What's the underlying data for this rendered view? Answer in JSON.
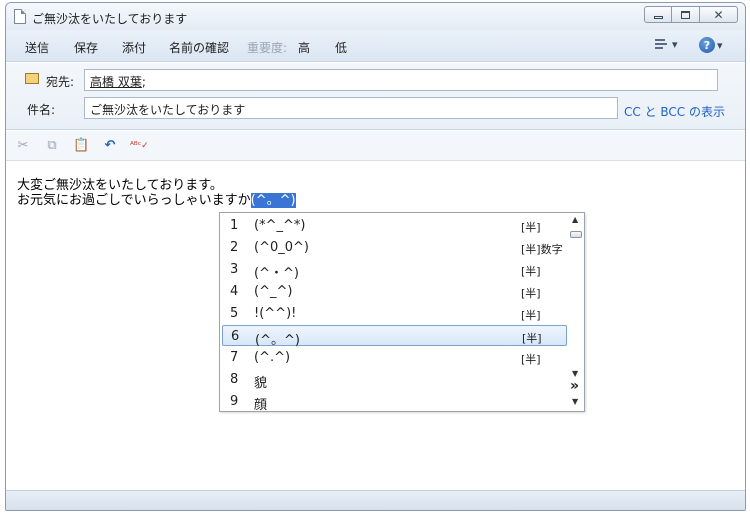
{
  "window": {
    "title": "ご無沙汰をいたしております"
  },
  "commands": {
    "send": "送信",
    "save": "保存",
    "attach": "添付",
    "check_names": "名前の確認",
    "importance_label": "重要度:",
    "high": "高",
    "low": "低"
  },
  "fields": {
    "to_label": "宛先:",
    "to_name": "高橋 双葉",
    "to_sep": ";",
    "subject_label": "件名:",
    "subject_value": "ご無沙汰をいたしております",
    "cc_bcc": "CC と BCC の表示"
  },
  "toolbar_icons": [
    "cut-icon",
    "copy-icon",
    "paste-icon",
    "undo-icon",
    "spellcheck-icon"
  ],
  "body": {
    "line1": "大変ご無沙汰をいたしております。",
    "line2_prefix": "お元気にお過ごしでいらっしゃいますか",
    "line2_selected": "(^。^)"
  },
  "candidates": [
    {
      "num": "1",
      "text": "(*^_^*)",
      "tag": "[半]"
    },
    {
      "num": "2",
      "text": "(^0_0^)",
      "tag": "[半]数字"
    },
    {
      "num": "3",
      "text": "(^・^)",
      "tag": "[半]"
    },
    {
      "num": "4",
      "text": "(^_^)",
      "tag": "[半]"
    },
    {
      "num": "5",
      "text": "!(^^)!",
      "tag": "[半]"
    },
    {
      "num": "6",
      "text": "(^。^)",
      "tag": "[半]"
    },
    {
      "num": "7",
      "text": "(^.^)",
      "tag": "[半]"
    },
    {
      "num": "8",
      "text": "貌",
      "tag": ""
    },
    {
      "num": "9",
      "text": "顔",
      "tag": ""
    }
  ],
  "selected_candidate": "6",
  "colors": {
    "accent": "#3a75d6",
    "link": "#1f62c4",
    "highlight_border": "#7da2ce"
  }
}
